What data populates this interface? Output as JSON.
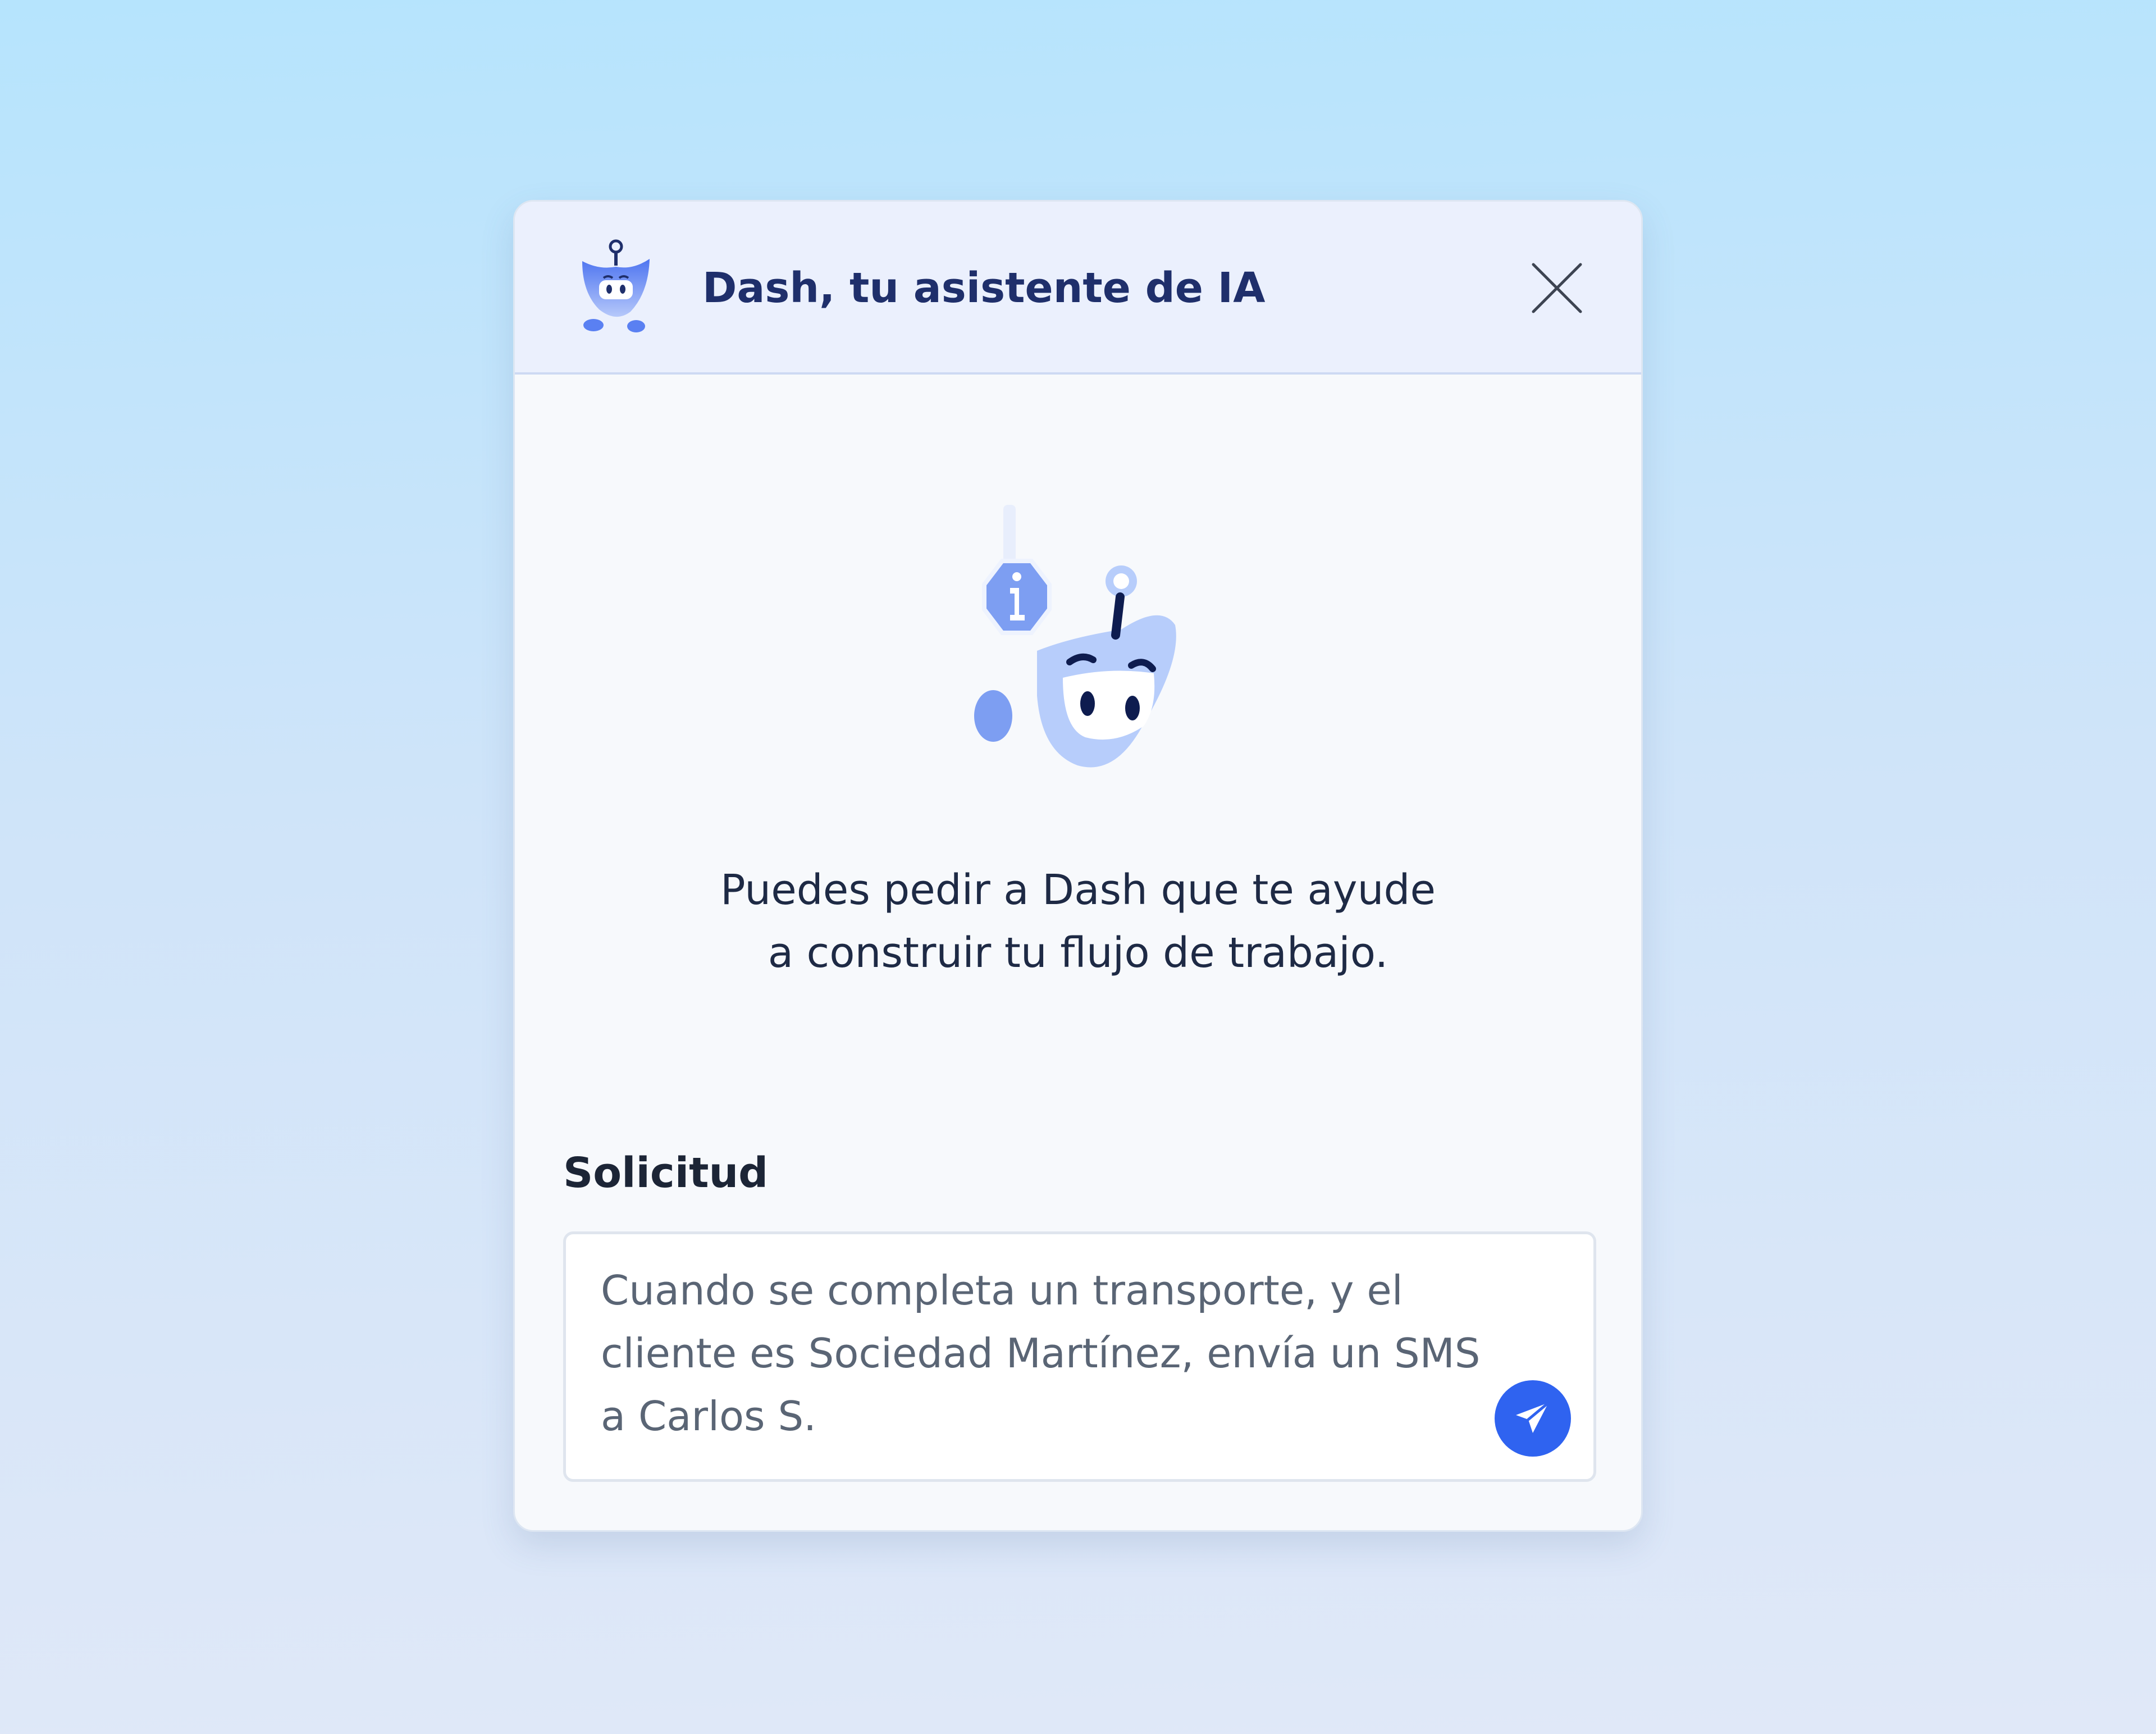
{
  "assistant": {
    "title": "Dash, tu asistente de IA",
    "avatar_icon": "robot-mascot-icon",
    "close_icon": "close-icon"
  },
  "intro": {
    "line1": "Puedes pedir a Dash que te ayude",
    "line2": "a construir tu flujo de trabajo.",
    "illustration_icon": "robot-info-icon"
  },
  "request": {
    "label": "Solicitud",
    "value_lines": [
      "Cuando se completa un transporte, y el",
      "cliente es Sociedad Martínez, envía un SMS",
      "a Carlos S."
    ],
    "send_icon": "send-icon"
  },
  "colors": {
    "accent": "#2f63f0",
    "title": "#1f2f6b",
    "header_bg": "#ebf0fd",
    "mascot": "#b7cdfb"
  }
}
